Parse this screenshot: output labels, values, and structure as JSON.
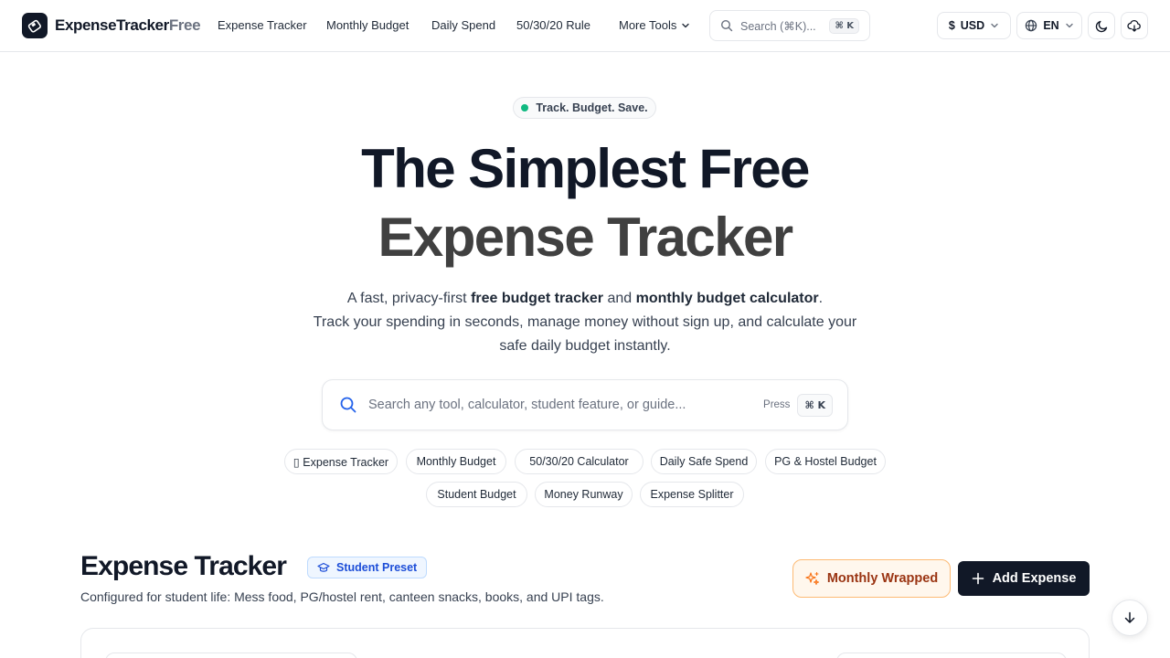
{
  "nav": {
    "logo_main": "ExpenseTracker",
    "logo_accent": "Free",
    "links": [
      "Expense Tracker",
      "Monthly Budget",
      "Daily Spend",
      "50/30/20 Rule"
    ],
    "more_label": "More Tools",
    "search_placeholder": "Search (⌘K)...",
    "search_kbd": "⌘ K",
    "currency_symbol": "$",
    "currency": "USD",
    "language": "EN"
  },
  "hero": {
    "badge": "Track. Budget. Save.",
    "title_line1": "The Simplest Free",
    "title_line2": "Expense Tracker",
    "sub_part1": "A fast, privacy-first ",
    "sub_bold1": "free budget tracker",
    "sub_part2": " and ",
    "sub_bold2": "monthly budget calculator",
    "sub_part3": ".",
    "sub_line2": "Track your spending in seconds, manage money without sign up, and calculate your safe daily budget instantly.",
    "search_placeholder": "Search any tool, calculator, student feature, or guide...",
    "search_press": "Press",
    "search_kbd": "⌘ K"
  },
  "chips": [
    "▯ Expense Tracker",
    "Monthly Budget",
    "50/30/20 Calculator",
    "Daily Safe Spend",
    "PG & Hostel Budget",
    "Student Budget",
    "Money Runway",
    "Expense Splitter"
  ],
  "section": {
    "title": "Expense Tracker",
    "preset": "Student Preset",
    "description": "Configured for student life: Mess food, PG/hostel rent, canteen snacks, books, and UPI tags.",
    "wrapped_label": "Monthly Wrapped",
    "add_label": "Add Expense"
  },
  "colors": {
    "primary": "#111827",
    "accent_green": "#10b981",
    "preset_blue": "#1d4ed8",
    "wrapped_orange": "#9a3412"
  }
}
